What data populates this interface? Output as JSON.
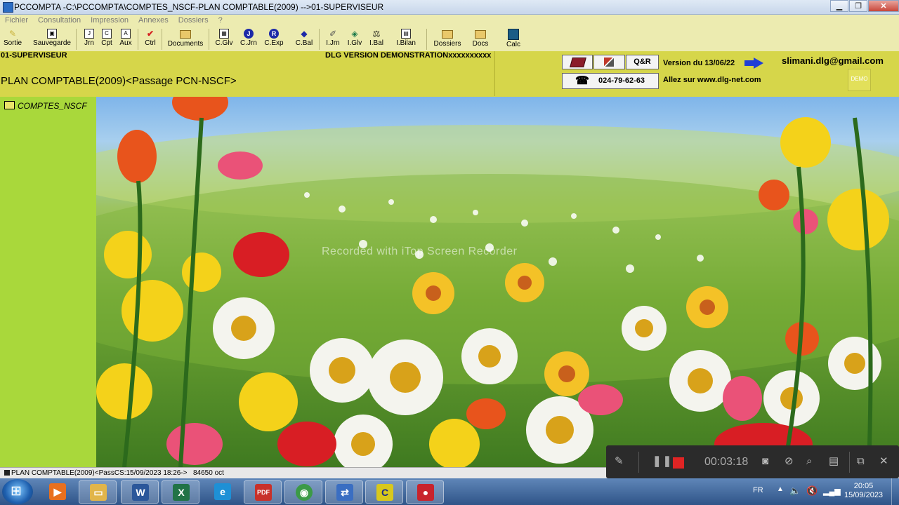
{
  "window": {
    "title": "PCCOMPTA -C:\\PCCOMPTA\\COMPTES_NSCF-PLAN COMPTABLE(2009) -->01-SUPERVISEUR",
    "minimize_icon": "minimize-icon",
    "restore_icon": "restore-icon",
    "close_icon": "close-icon"
  },
  "menu": [
    "Fichier",
    "Consultation",
    "Impression",
    "Annexes",
    "Dossiers",
    "?"
  ],
  "toolbar": [
    {
      "label": "Sortie",
      "icon": "pen-icon"
    },
    {
      "label": "Sauvegarde",
      "icon": "save-icon"
    },
    {
      "label": "Jrn",
      "icon": "journal-icon"
    },
    {
      "label": "Cpt",
      "icon": "account-icon"
    },
    {
      "label": "Aux",
      "icon": "auxiliary-icon"
    },
    {
      "label": "Ctrl",
      "icon": "check-icon"
    },
    {
      "label": "Documents",
      "icon": "folder-icon"
    },
    {
      "label": "C.Glv",
      "icon": "ledger-icon"
    },
    {
      "label": "C.Jrn",
      "icon": "journal-circle-icon"
    },
    {
      "label": "C.Exp",
      "icon": "export-circle-icon"
    },
    {
      "label": "C.Bal",
      "icon": "balance-diamond-icon"
    },
    {
      "label": "I.Jrn",
      "icon": "print-journal-icon"
    },
    {
      "label": "I.Glv",
      "icon": "print-ledger-icon"
    },
    {
      "label": "I.Bal",
      "icon": "scales-icon"
    },
    {
      "label": "I.Bilan",
      "icon": "report-icon"
    },
    {
      "label": "Dossiers",
      "icon": "folder-open-icon"
    },
    {
      "label": "Docs",
      "icon": "folder-docs-icon"
    },
    {
      "label": "Calc",
      "icon": "calculator-icon"
    }
  ],
  "header": {
    "user": "01-SUPERVISEUR",
    "demo": "DLG VERSION DEMONSTRATIONxxxxxxxxxx",
    "plan": "PLAN COMPTABLE(2009)<Passage PCN-NSCF>",
    "qr_label": "Q&R",
    "phone": "024-79-62-63",
    "version": "Version du 13/06/22",
    "site": "Allez sur  www.dlg-net.com",
    "email": "slimani.dlg@gmail.com",
    "demo_badge": "DEMO"
  },
  "sidebar": {
    "tree_item": "COMPTES_NSCF"
  },
  "watermark": "Recorded with iTop Screen Recorder",
  "status": {
    "text": "PLAN COMPTABLE(2009)<PassCS:15/09/2023 18:26->",
    "size": "84650 oct"
  },
  "recorder": {
    "time": "00:03:18"
  },
  "taskbar": {
    "apps": [
      {
        "icon": "media-player-icon",
        "color": "#e8701e"
      },
      {
        "icon": "file-explorer-icon",
        "color": "#e1b54a"
      },
      {
        "icon": "word-icon",
        "color": "#2b579a"
      },
      {
        "icon": "excel-icon",
        "color": "#217346"
      },
      {
        "icon": "internet-explorer-icon",
        "color": "#1e90d6"
      },
      {
        "icon": "pdf-icon",
        "color": "#c8312a"
      },
      {
        "icon": "chrome-icon",
        "color": "#3c9a47"
      },
      {
        "icon": "remote-app-icon",
        "color": "#3a6ec2"
      },
      {
        "icon": "pccompta-icon",
        "color": "#d8c81c"
      },
      {
        "icon": "recorder-app-icon",
        "color": "#c8232c"
      }
    ],
    "lang": "FR",
    "time": "20:05",
    "date": "15/09/2023"
  }
}
